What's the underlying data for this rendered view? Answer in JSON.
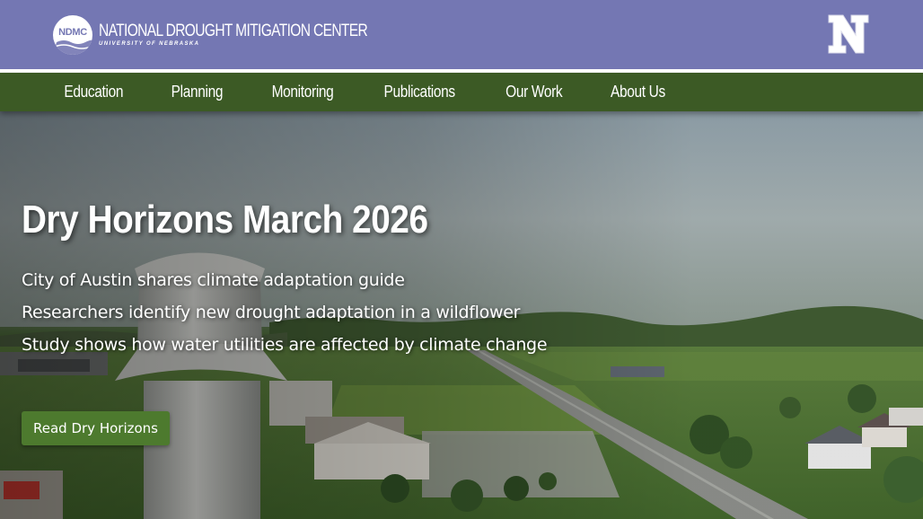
{
  "header": {
    "logo_badge": "NDMC",
    "logo_title": "NATIONAL DROUGHT MITIGATION CENTER",
    "logo_subtitle": "UNIVERSITY OF NEBRASKA",
    "brand_color": "#7477b3",
    "university_logo": "N"
  },
  "nav": {
    "color": "#3c5a25",
    "items": [
      {
        "label": "Education"
      },
      {
        "label": "Planning"
      },
      {
        "label": "Monitoring"
      },
      {
        "label": "Publications"
      },
      {
        "label": "Our Work"
      },
      {
        "label": "About Us"
      }
    ]
  },
  "hero": {
    "title": "Dry Horizons March 2026",
    "links": [
      {
        "text": "City of Austin shares climate adaptation guide"
      },
      {
        "text": "Researchers identify new drought adaptation in a wildflower"
      },
      {
        "text": "Study shows how water utilities are affected by climate change"
      }
    ],
    "cta_label": "Read Dry Horizons",
    "cta_color": "#4d7a2e"
  }
}
